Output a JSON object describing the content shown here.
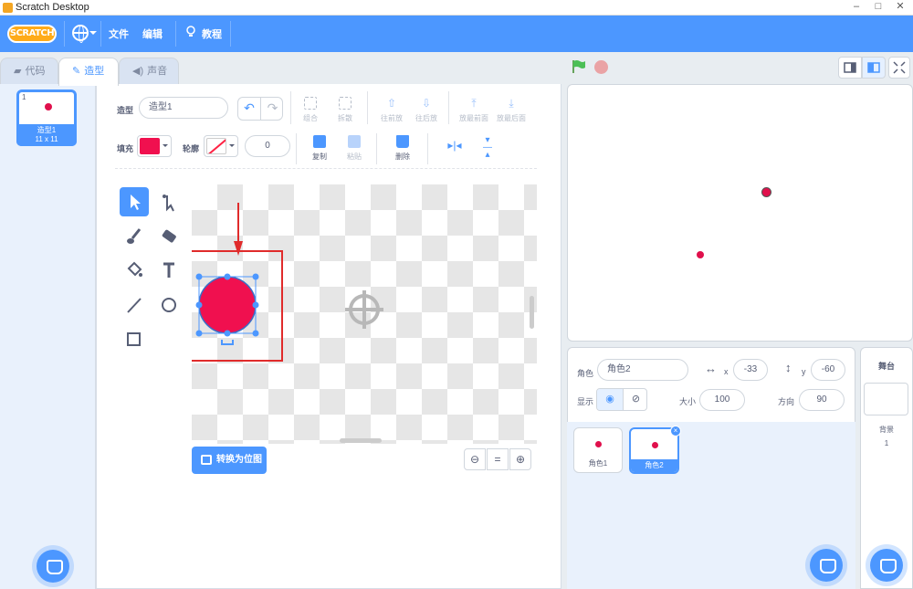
{
  "window": {
    "title": "Scratch Desktop"
  },
  "menu": {
    "logo": "SCRATCH",
    "file": "文件",
    "edit": "编辑",
    "tutorials": "教程"
  },
  "tabs": [
    {
      "label": "代码"
    },
    {
      "label": "造型"
    },
    {
      "label": "声音"
    }
  ],
  "costume_list": [
    {
      "index": "1",
      "name": "造型1",
      "size": "11 x 11"
    }
  ],
  "editor": {
    "costume_label": "造型",
    "costume_name": "造型1",
    "fill_label": "填充",
    "outline_label": "轮廓",
    "outline_width": "0",
    "group": "组合",
    "ungroup": "拆散",
    "forward": "往前放",
    "backward": "往后放",
    "front": "放最前面",
    "back": "放最后面",
    "copy": "复制",
    "paste": "粘贴",
    "delete": "删除",
    "convert": "转换为位图",
    "fill_color": "#f0104f"
  },
  "sprite_info": {
    "sprite_label": "角色",
    "sprite_name": "角色2",
    "x_label": "x",
    "x": "-33",
    "y_label": "y",
    "y": "-60",
    "show_label": "显示",
    "size_label": "大小",
    "size": "100",
    "direction_label": "方向",
    "direction": "90"
  },
  "sprites": [
    {
      "name": "角色1"
    },
    {
      "name": "角色2"
    }
  ],
  "stage_panel": {
    "title": "舞台",
    "backdrop_label": "背景",
    "backdrop_count": "1"
  },
  "colors": {
    "accent": "#4c97ff",
    "sprite": "#e0104c",
    "highlight": "#e02b2b"
  }
}
